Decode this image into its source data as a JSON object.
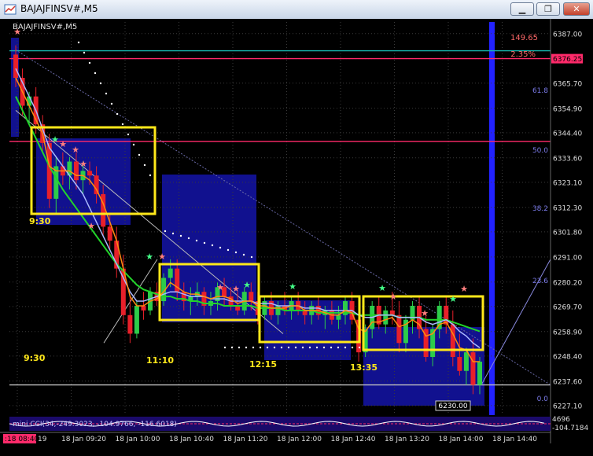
{
  "window": {
    "title": "BAJAJFINSV#,M5",
    "buttons": [
      "minimize",
      "restore",
      "close"
    ]
  },
  "chart_data": {
    "type": "candlestick",
    "symbol_label": "BAJAJFINSV#,M5",
    "ylim": [
      6223,
      6392
    ],
    "y_ticks": [
      6387.0,
      6376.25,
      6365.7,
      6354.9,
      6344.4,
      6333.6,
      6323.1,
      6312.3,
      6301.8,
      6291.0,
      6280.2,
      6269.7,
      6258.9,
      6248.4,
      6237.6,
      6227.1
    ],
    "x_labels": [
      "18 Jan 08:40",
      "18 Jan 09:20",
      "18 Jan 10:00",
      "18 Jan 10:40",
      "18 Jan 11:20",
      "18 Jan 12:00",
      "18 Jan 12:40",
      "18 Jan 13:20",
      "18 Jan 14:00",
      "18 Jan 14:40"
    ],
    "x_label_shortcut": "19",
    "candles": [
      [
        6378,
        6382,
        6364,
        6368
      ],
      [
        6368,
        6372,
        6352,
        6356
      ],
      [
        6356,
        6362,
        6348,
        6360
      ],
      [
        6360,
        6364,
        6344,
        6348
      ],
      [
        6348,
        6352,
        6336,
        6340
      ],
      [
        6340,
        6344,
        6312,
        6316
      ],
      [
        6316,
        6334,
        6310,
        6330
      ],
      [
        6330,
        6336,
        6322,
        6326
      ],
      [
        6326,
        6334,
        6320,
        6332
      ],
      [
        6332,
        6336,
        6320,
        6324
      ],
      [
        6324,
        6332,
        6318,
        6328
      ],
      [
        6328,
        6332,
        6322,
        6326
      ],
      [
        6326,
        6330,
        6314,
        6318
      ],
      [
        6318,
        6322,
        6300,
        6304
      ],
      [
        6304,
        6310,
        6294,
        6298
      ],
      [
        6298,
        6304,
        6282,
        6286
      ],
      [
        6286,
        6292,
        6262,
        6266
      ],
      [
        6266,
        6274,
        6254,
        6258
      ],
      [
        6258,
        6272,
        6256,
        6270
      ],
      [
        6270,
        6276,
        6264,
        6268
      ],
      [
        6268,
        6278,
        6266,
        6276
      ],
      [
        6276,
        6280,
        6270,
        6272
      ],
      [
        6272,
        6284,
        6270,
        6282
      ],
      [
        6282,
        6290,
        6278,
        6286
      ],
      [
        6286,
        6290,
        6272,
        6276
      ],
      [
        6276,
        6280,
        6268,
        6272
      ],
      [
        6272,
        6278,
        6266,
        6274
      ],
      [
        6274,
        6280,
        6270,
        6276
      ],
      [
        6276,
        6278,
        6266,
        6270
      ],
      [
        6270,
        6276,
        6266,
        6272
      ],
      [
        6272,
        6280,
        6268,
        6278
      ],
      [
        6278,
        6282,
        6270,
        6274
      ],
      [
        6274,
        6278,
        6268,
        6270
      ],
      [
        6270,
        6276,
        6266,
        6268
      ],
      [
        6268,
        6278,
        6266,
        6276
      ],
      [
        6276,
        6280,
        6268,
        6272
      ],
      [
        6272,
        6276,
        6262,
        6266
      ],
      [
        6266,
        6274,
        6264,
        6272
      ],
      [
        6272,
        6276,
        6264,
        6266
      ],
      [
        6266,
        6272,
        6262,
        6270
      ],
      [
        6270,
        6276,
        6266,
        6268
      ],
      [
        6268,
        6274,
        6264,
        6272
      ],
      [
        6272,
        6276,
        6266,
        6268
      ],
      [
        6268,
        6272,
        6262,
        6266
      ],
      [
        6266,
        6272,
        6262,
        6270
      ],
      [
        6270,
        6274,
        6264,
        6266
      ],
      [
        6266,
        6270,
        6260,
        6268
      ],
      [
        6268,
        6272,
        6262,
        6264
      ],
      [
        6264,
        6270,
        6260,
        6266
      ],
      [
        6266,
        6274,
        6262,
        6272
      ],
      [
        6272,
        6276,
        6262,
        6264
      ],
      [
        6264,
        6270,
        6246,
        6250
      ],
      [
        6250,
        6262,
        6248,
        6260
      ],
      [
        6260,
        6272,
        6256,
        6270
      ],
      [
        6270,
        6274,
        6260,
        6262
      ],
      [
        6262,
        6270,
        6258,
        6268
      ],
      [
        6268,
        6276,
        6262,
        6266
      ],
      [
        6266,
        6272,
        6250,
        6254
      ],
      [
        6254,
        6266,
        6250,
        6264
      ],
      [
        6264,
        6272,
        6258,
        6270
      ],
      [
        6270,
        6274,
        6256,
        6260
      ],
      [
        6260,
        6266,
        6246,
        6248
      ],
      [
        6248,
        6262,
        6244,
        6260
      ],
      [
        6260,
        6272,
        6256,
        6270
      ],
      [
        6270,
        6274,
        6258,
        6262
      ],
      [
        6262,
        6268,
        6244,
        6248
      ],
      [
        6248,
        6258,
        6240,
        6242
      ],
      [
        6242,
        6252,
        6236,
        6250
      ],
      [
        6250,
        6256,
        6232,
        6236
      ],
      [
        6236,
        6248,
        6232,
        6246
      ]
    ],
    "series": [
      {
        "values": [
          6360,
          6354,
          6348,
          6342,
          6336,
          6330,
          6325,
          6320,
          6316,
          6312,
          6308,
          6304,
          6300,
          6296,
          6292,
          6288,
          6285,
          6282,
          6279,
          6277,
          6276,
          6275,
          6274,
          6274,
          6273,
          6273,
          6272,
          6272,
          6271,
          6271,
          6271,
          6270,
          6270,
          6270,
          6270,
          6270,
          6269,
          6269,
          6269,
          6269,
          6268,
          6268,
          6268,
          6268,
          6268,
          6267,
          6267,
          6267,
          6267,
          6267,
          6267,
          6266,
          6266,
          6266,
          6266,
          6266,
          6266,
          6265,
          6265,
          6265,
          6265,
          6264,
          6264,
          6264,
          6264,
          6263,
          6262,
          6261,
          6260,
          6259
        ]
      },
      {
        "values": [
          6372,
          6366,
          6360,
          6354,
          6346,
          6338,
          6334,
          6330,
          6326,
          6322,
          6318,
          6312,
          6306,
          6300,
          6294,
          6288,
          6282,
          6276,
          6272,
          6272,
          6273,
          6274,
          6275,
          6276,
          6276,
          6275,
          6274,
          6274,
          6274,
          6273,
          6273,
          6273,
          6272,
          6272,
          6272,
          6272,
          6271,
          6271,
          6271,
          6270,
          6270,
          6270,
          6270,
          6269,
          6269,
          6269,
          6268,
          6268,
          6268,
          6268,
          6268,
          6266,
          6265,
          6265,
          6266,
          6266,
          6266,
          6265,
          6265,
          6265,
          6265,
          6263,
          6262,
          6263,
          6264,
          6262,
          6259,
          6257,
          6254,
          6252
        ]
      },
      {
        "values": [
          6368,
          6362,
          6356,
          6350,
          6344,
          6330,
          6328,
          6328,
          6328,
          6326,
          6326,
          6324,
          6320,
          6314,
          6306,
          6298,
          6286,
          6274,
          6270,
          6270,
          6272,
          6273,
          6276,
          6280,
          6278,
          6276,
          6275,
          6275,
          6274,
          6273,
          6274,
          6274,
          6273,
          6271,
          6272,
          6272,
          6270,
          6270,
          6269,
          6269,
          6269,
          6270,
          6270,
          6268,
          6268,
          6268,
          6267,
          6266,
          6266,
          6268,
          6267,
          6260,
          6259,
          6263,
          6263,
          6264,
          6265,
          6261,
          6262,
          6264,
          6262,
          6257,
          6258,
          6262,
          6263,
          6258,
          6252,
          6251,
          6246,
          6246
        ]
      }
    ],
    "horizontal_lines": [
      {
        "price": 6379.65,
        "label": "6379.65",
        "color": "#17b8b0"
      },
      {
        "price": 6376.25,
        "label": "6376.25",
        "color": "#ff2a6a"
      },
      {
        "price": 6340.7,
        "label": "6340.70",
        "color": "#ff2a6a"
      },
      {
        "price": 6236.0,
        "label": "6236.00",
        "color": "#c0c0c0"
      }
    ],
    "fib_levels": [
      "61.8",
      "50.0",
      "38.2",
      "23.6",
      "0.0"
    ],
    "top_annotations": [
      "149.65",
      "2.35%"
    ],
    "price_box_label": "6230.00",
    "time_annotations": [
      "9:30",
      "9:30",
      "11:10",
      "12:15",
      "13:35"
    ],
    "indicator_label": "mini CCI(34,-249.3023, -104.9766, -116.6018)",
    "indicator_values": [
      "4696",
      "-104.7184"
    ],
    "colors": {
      "bull": "#2dcc4a",
      "bear": "#e8202a",
      "blue_zone": "#1414a8",
      "yellow_box": "#ffe81a",
      "grid": "#3a3a3a",
      "accent": "#2222ff"
    }
  }
}
